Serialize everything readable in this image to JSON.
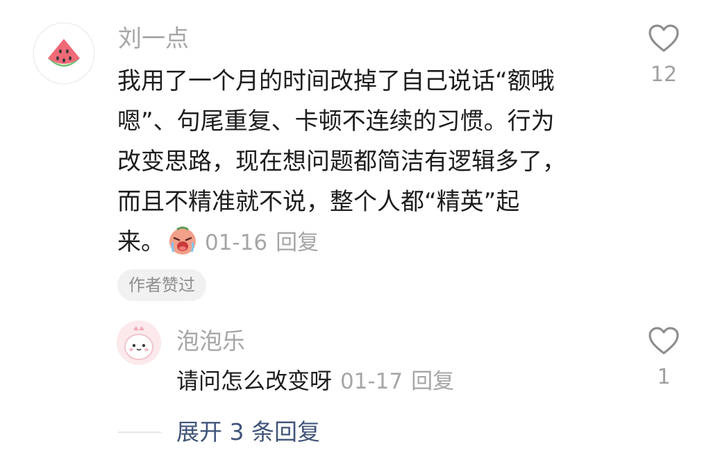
{
  "comment": {
    "username": "刘一点",
    "avatar_icon": "watermelon-icon",
    "text_lines": [
      "我用了一个月的时间改掉了自己说话“额哦",
      "嗯”、句尾重复、卡顿不连续的习惯。行为",
      "改变思路，现在想问题都简洁有逻辑多了，",
      "而且不精准就不说，整个人都“精英”起",
      "来。"
    ],
    "inline_emoji": "crying-face-emoji",
    "date": "01-16",
    "reply_label": "回复",
    "badge": "作者赞过",
    "like_count": "12"
  },
  "reply": {
    "username": "泡泡乐",
    "avatar_icon": "pink-dinosaur-icon",
    "text": "请问怎么改变呀",
    "date": "01-17",
    "reply_label": "回复",
    "like_count": "1"
  },
  "expand_replies": {
    "label": "展开 3 条回复"
  },
  "colors": {
    "text": "#1d1d1d",
    "meta": "#a6a6a6",
    "link": "#41557a",
    "badge_bg": "#f1f1f1"
  }
}
